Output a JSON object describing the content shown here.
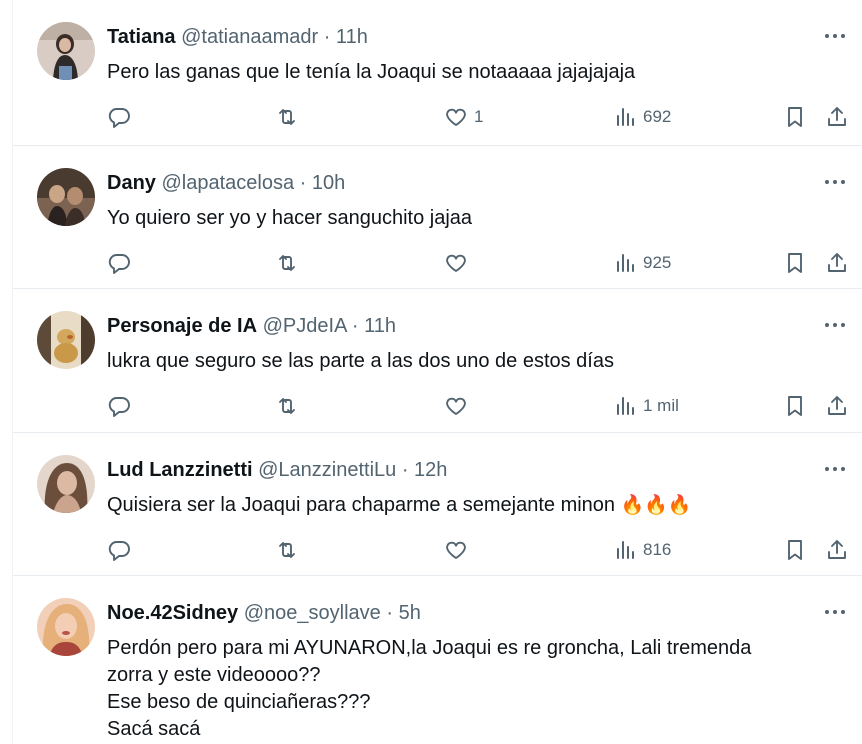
{
  "tweets": [
    {
      "name": "Tatiana",
      "handle": "@tatianaamadr",
      "time": "· 11h",
      "text": [
        "Pero las ganas que le tenía la Joaqui se notaaaaa jajajajaja"
      ],
      "likes": "1",
      "views": "692",
      "avatar_colors": [
        "#c9b8a8",
        "#3a2c26",
        "#e2d6cf"
      ]
    },
    {
      "name": "Dany",
      "handle": "@lapatacelosa",
      "time": "· 10h",
      "text": [
        "Yo quiero ser yo y hacer sanguchito jajaa"
      ],
      "likes": "",
      "views": "925",
      "avatar_colors": [
        "#5b4a3e",
        "#2b2420",
        "#9c7f68"
      ]
    },
    {
      "name": "Personaje de IA",
      "handle": "@PJdeIA",
      "time": "· 11h",
      "text": [
        "lukra que seguro se las parte a las dos uno de estos días"
      ],
      "likes": "",
      "views": "1 mil",
      "avatar_colors": [
        "#d9c7a8",
        "#6a5540",
        "#f1e4cc"
      ]
    },
    {
      "name": "Lud Lanzzinetti",
      "handle": "@LanzzinettiLu",
      "time": "· 12h",
      "text": [
        "Quisiera ser la Joaqui para chaparme a semejante minon"
      ],
      "emoji": "🔥🔥🔥",
      "likes": "",
      "views": "816",
      "avatar_colors": [
        "#c8b2a0",
        "#6b4e3c",
        "#e8dbd0"
      ]
    },
    {
      "name": "Noe.42Sidney",
      "handle": "@noe_soyllave",
      "time": "· 5h",
      "text": [
        "Perdón pero para mi AYUNARON,la Joaqui es re groncha, Lali tremenda",
        "zorra y este videoooo??",
        "Ese beso de quinciañeras???",
        "Sacá sacá"
      ],
      "avatar_colors": [
        "#e8b89a",
        "#b45a4a",
        "#f5d6c0"
      ]
    }
  ],
  "icons": {
    "reply": "reply-icon",
    "retweet": "retweet-icon",
    "like": "heart-icon",
    "views": "views-icon",
    "bookmark": "bookmark-icon",
    "share": "share-icon",
    "more": "more-icon"
  },
  "colors": {
    "text": "#0f1419",
    "secondary": "#536471",
    "divider": "#e6ecf0"
  }
}
